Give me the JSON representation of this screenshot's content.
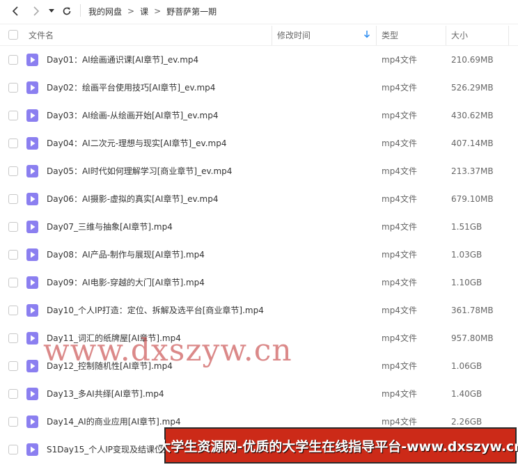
{
  "breadcrumb": [
    "我的网盘",
    "课",
    "野菩萨第一期"
  ],
  "breadcrumb_separator": ">",
  "columns": {
    "name": "文件名",
    "modified": "修改时间",
    "type": "类型",
    "size": "大小"
  },
  "colors": {
    "file_icon": "#8b7ff0",
    "banner_bg": "#cc2a18",
    "sort_arrow": "#2b8cf0"
  },
  "files": [
    {
      "name": "Day01：AI绘画通识课[AI章节]_ev.mp4",
      "type": "mp4文件",
      "size": "210.69MB"
    },
    {
      "name": "Day02：绘画平台使用技巧[AI章节]_ev.mp4",
      "type": "mp4文件",
      "size": "526.29MB"
    },
    {
      "name": "Day03：AI绘画-从绘画开始[AI章节]_ev.mp4",
      "type": "mp4文件",
      "size": "430.62MB"
    },
    {
      "name": "Day04：AI二次元-理想与现实[AI章节]_ev.mp4",
      "type": "mp4文件",
      "size": "407.14MB"
    },
    {
      "name": "Day05：AI时代如何理解学习[商业章节]_ev.mp4",
      "type": "mp4文件",
      "size": "213.37MB"
    },
    {
      "name": "Day06：AI摄影-虚拟的真实[AI章节]_ev.mp4",
      "type": "mp4文件",
      "size": "679.10MB"
    },
    {
      "name": "Day07_三维与抽象[AI章节].mp4",
      "type": "mp4文件",
      "size": "1.51GB"
    },
    {
      "name": "Day08：AI产品-制作与展现[AI章节].mp4",
      "type": "mp4文件",
      "size": "1.03GB"
    },
    {
      "name": "Day09：AI电影-穿越的大门[AI章节].mp4",
      "type": "mp4文件",
      "size": "1.10GB"
    },
    {
      "name": "Day10_个人IP打造：定位、拆解及选平台[商业章节].mp4",
      "type": "mp4文件",
      "size": "361.78MB"
    },
    {
      "name": "Day11_词汇的纸牌屋[AI章节].mp4",
      "type": "mp4文件",
      "size": "957.80MB"
    },
    {
      "name": "Day12_控制随机性[AI章节].mp4",
      "type": "mp4文件",
      "size": "1.06GB"
    },
    {
      "name": "Day13_多AI共绎[AI章节].mp4",
      "type": "mp4文件",
      "size": "1.40GB"
    },
    {
      "name": "Day14_AI的商业应用[AI章节].mp4",
      "type": "mp4文件",
      "size": "2.26GB"
    },
    {
      "name": "S1Day15_个人IP变现及结课仪式",
      "type": "",
      "size": ""
    }
  ],
  "watermark": "www.dxszyw.cn",
  "banner": "大学生资源网-优质的大学生在线指导平台-www.dxszyw.cn"
}
